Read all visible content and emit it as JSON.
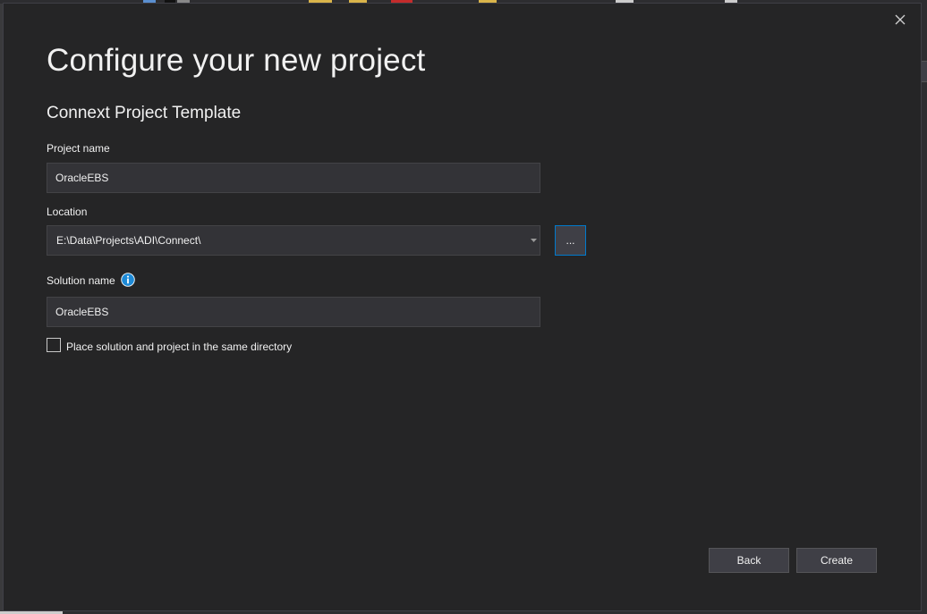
{
  "dialog": {
    "title": "Configure your new project",
    "subtitle": "Connext Project Template",
    "close_icon": "close-icon"
  },
  "form": {
    "project_name_label": "Project name",
    "project_name_value": "OracleEBS",
    "location_label": "Location",
    "location_value": "E:\\Data\\Projects\\ADI\\Connect\\",
    "browse_label": "...",
    "solution_name_label": "Solution name",
    "solution_info_icon": "info-icon",
    "solution_name_value": "OracleEBS",
    "same_directory_label": "Place solution and project in the same directory",
    "same_directory_checked": false
  },
  "buttons": {
    "back": "Back",
    "create": "Create"
  },
  "colors": {
    "dialog_bg": "#252526",
    "field_bg": "#333337",
    "field_border": "#434346",
    "accent": "#007acc",
    "info_icon": "#1e8ad6",
    "text": "#f1f1f1"
  }
}
